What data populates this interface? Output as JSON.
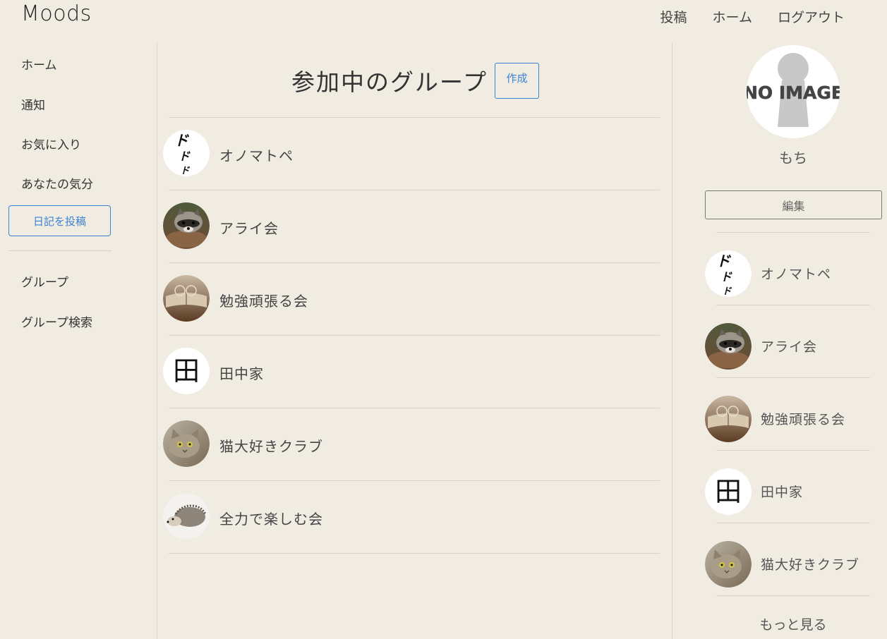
{
  "app": {
    "logo": "Moods"
  },
  "topnav": {
    "post": "投稿",
    "home": "ホーム",
    "logout": "ログアウト"
  },
  "sidebar": {
    "items": [
      "ホーム",
      "通知",
      "お気に入り",
      "あなたの気分"
    ],
    "post_diary_button": "日記を投稿",
    "items2": [
      "グループ",
      "グループ検索"
    ]
  },
  "main": {
    "title": "参加中のグループ",
    "create_button": "作成",
    "groups": [
      {
        "name": "オノマトペ",
        "avatar": "dodo-icon"
      },
      {
        "name": "アライ会",
        "avatar": "raccoon-icon"
      },
      {
        "name": "勉強頑張る会",
        "avatar": "book-icon"
      },
      {
        "name": "田中家",
        "avatar": "kanji-ta-icon"
      },
      {
        "name": "猫大好きクラブ",
        "avatar": "cat-icon"
      },
      {
        "name": "全力で楽しむ会",
        "avatar": "hedgehog-icon"
      }
    ]
  },
  "profile": {
    "no_image_text": "NO IMAGE",
    "username": "もち",
    "edit_button": "編集",
    "groups": [
      "オノマトペ",
      "アライ会",
      "勉強頑張る会",
      "田中家",
      "猫大好きクラブ"
    ],
    "more_link": "もっと見る"
  },
  "glyphs": {
    "dodo": "ド",
    "ta": "田"
  },
  "colors": {
    "background": "#f1ece2",
    "accent": "#3b82d6"
  }
}
